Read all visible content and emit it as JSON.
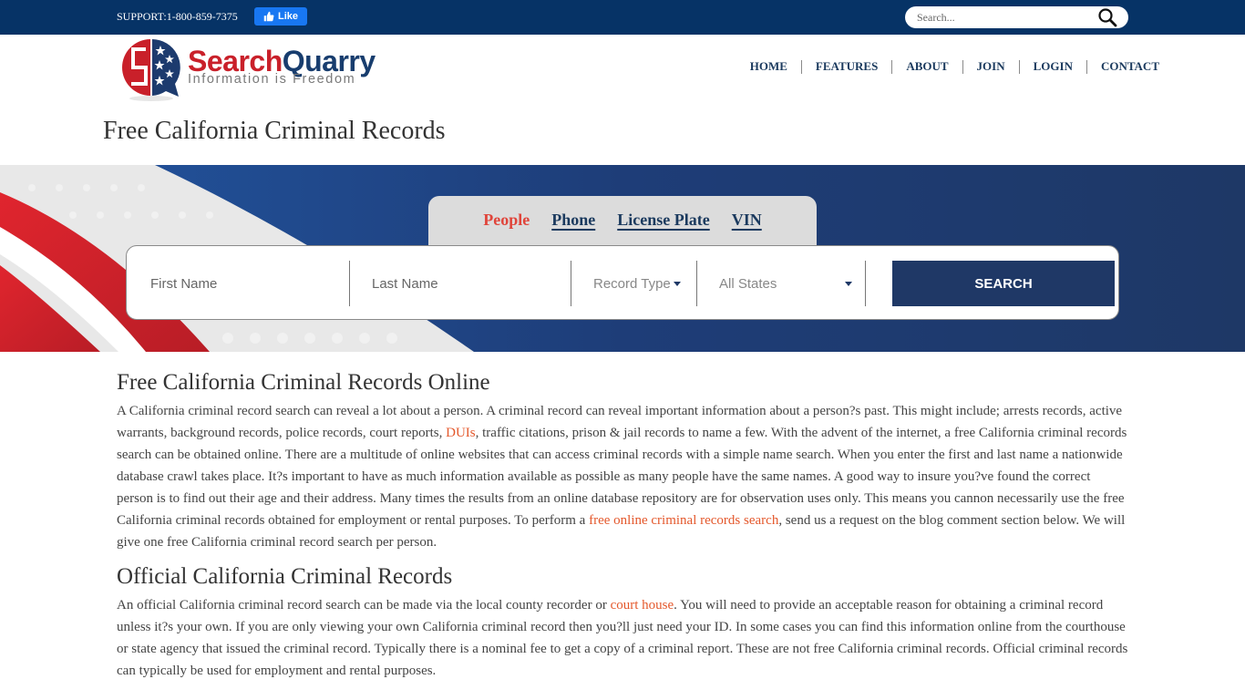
{
  "topbar": {
    "support_text": "SUPPORT:1-800-859-7375",
    "like_label": "Like",
    "search_placeholder": "Search..."
  },
  "header": {
    "logo": {
      "name_part1": "Search",
      "name_part2": "Quarry",
      "tagline": "Information is Freedom"
    },
    "nav": [
      {
        "label": "HOME"
      },
      {
        "label": "FEATURES"
      },
      {
        "label": "ABOUT"
      },
      {
        "label": "JOIN"
      },
      {
        "label": "LOGIN"
      },
      {
        "label": "CONTACT"
      }
    ]
  },
  "page_title": "Free California Criminal Records",
  "search_panel": {
    "tabs": [
      {
        "label": "People",
        "active": true
      },
      {
        "label": "Phone",
        "active": false
      },
      {
        "label": "License Plate",
        "active": false
      },
      {
        "label": "VIN",
        "active": false
      }
    ],
    "first_name_placeholder": "First Name",
    "last_name_placeholder": "Last Name",
    "record_type_value": "Record Type",
    "state_value": "All States",
    "search_button": "SEARCH"
  },
  "colors": {
    "navy": "#063366",
    "banner_blue": "#1e3866",
    "accent_red": "#e0453b",
    "link_orange": "#e4582c",
    "facebook_blue": "#1877f2"
  },
  "content": {
    "section1": {
      "heading": "Free California Criminal Records Online",
      "p_part1": "A California criminal record search can reveal a lot about a person. A criminal record can reveal important information about a person?s past. This might include; arrests records, active warrants, background records, police records, court reports, ",
      "link1": "DUIs",
      "p_part2": ", traffic citations, prison & jail records to name a few. With the advent of the internet, a free California criminal records search can be obtained online. There are a multitude of online websites that can access criminal records with a simple name search. When you enter the first and last name a nationwide database crawl takes place. It?s important to have as much information available as possible as many people have the same names. A good way to insure you?ve found the correct person is to find out their age and their address. Many times the results from an online database repository are for observation uses only. This means you cannon necessarily use the free California criminal records obtained for employment or rental purposes. To perform a ",
      "link2": "free online criminal records search",
      "p_part3": ", send us a request on the blog comment section below. We will give one free California criminal record search per person."
    },
    "section2": {
      "heading": "Official California Criminal Records",
      "p_part1": "An official California criminal record search can be made via the local county recorder or ",
      "link1": "court house",
      "p_part2": ". You will need to provide an acceptable reason for obtaining a criminal record unless it?s your own. If you are only viewing your own California criminal record then you?ll just need your ID. In some cases you can find this information online from the courthouse or state agency that issued the criminal record. Typically there is a nominal fee to get a copy of a criminal report. These are not free California criminal records. Official criminal records can typically be used for employment and rental purposes."
    }
  }
}
